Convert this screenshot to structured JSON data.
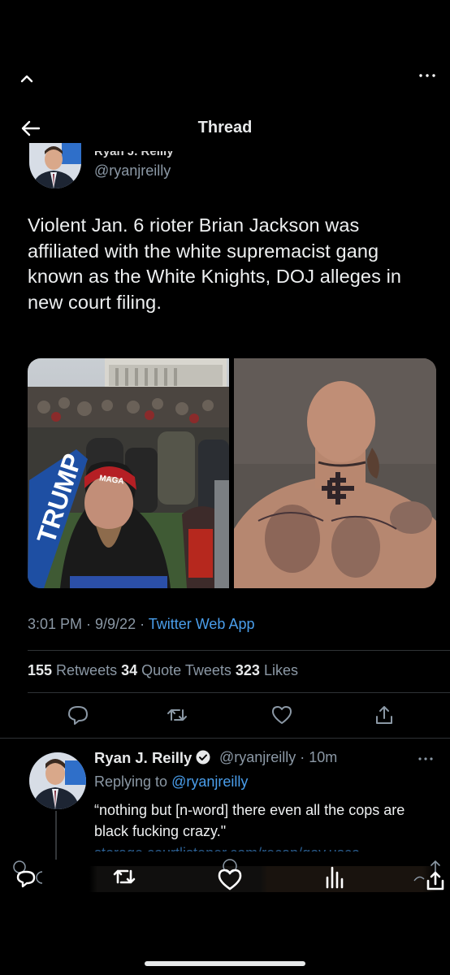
{
  "header": {
    "title": "Thread"
  },
  "tweet": {
    "author_name": "Ryan J. Reilly",
    "handle": "@ryanjreilly",
    "text": "Violent Jan. 6 rioter Brian Jackson was affiliated with the white supremacist gang known as the White Knights, DOJ alleges in new court filing.",
    "time": "3:01 PM · 9/9/22 · ",
    "source": "Twitter Web App",
    "retweets": "155",
    "retweets_label": " Retweets",
    "quotes": "34",
    "quotes_label": " Quote Tweets",
    "likes": "323",
    "likes_label": " Likes",
    "image1_caption": "MAGA",
    "image1_banner": "TRUMP"
  },
  "reply": {
    "name": "Ryan J. Reilly",
    "handle": "@ryanjreilly · 10m",
    "replying_prefix": "Replying to ",
    "replying_handle": "@ryanjreilly",
    "text": "“nothing but [n-word] there even all the cops are black fucking crazy.\"",
    "link": "storage.courtlistener.com/recap/gov.usco"
  },
  "colors": {
    "accent": "#4a9eeb",
    "muted": "#8b98a5",
    "background": "#000000",
    "verified": "#e7e9ea"
  }
}
